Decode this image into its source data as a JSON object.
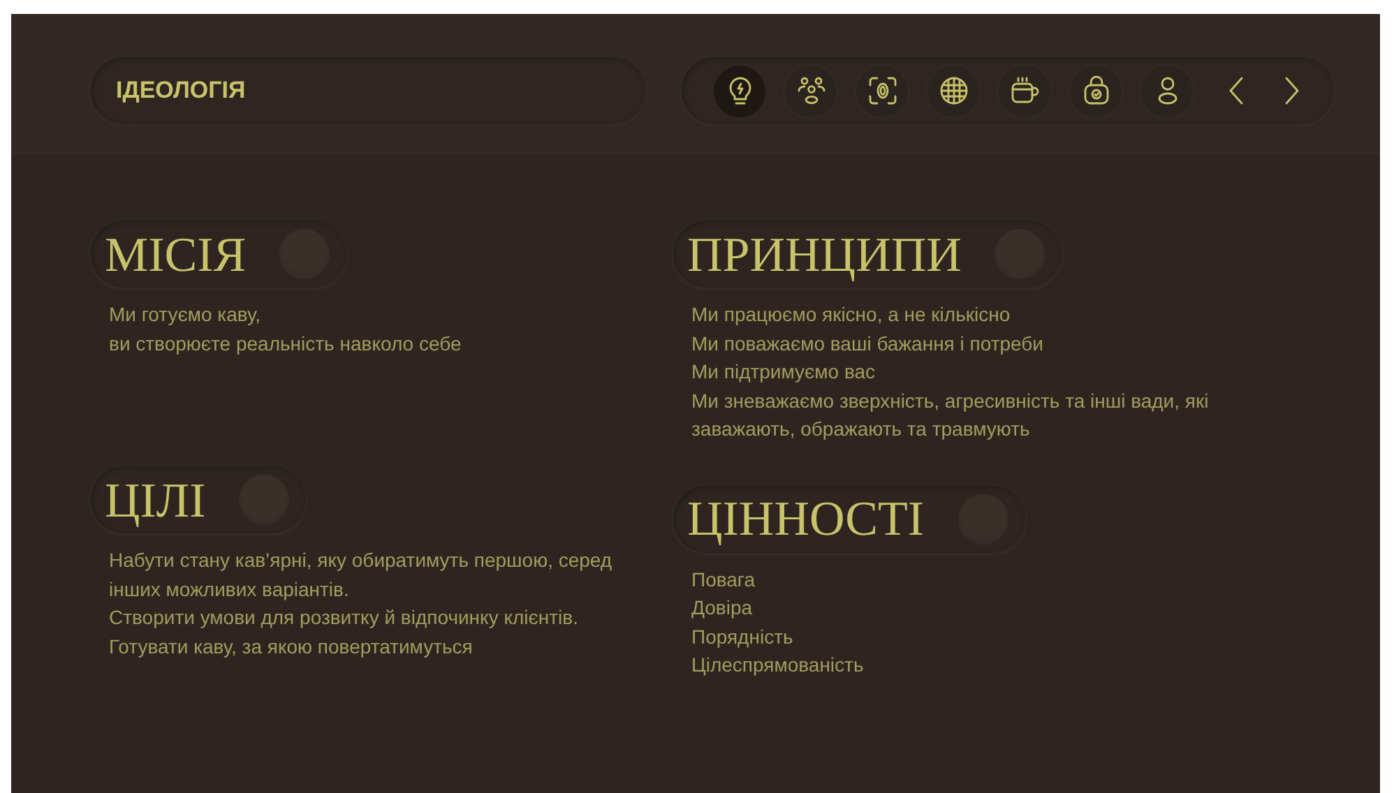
{
  "header": {
    "title": "ІДЕОЛОГІЯ"
  },
  "nav": {
    "icons": [
      {
        "kind": "bulb",
        "selected": true
      },
      {
        "kind": "people",
        "selected": false
      },
      {
        "kind": "scan",
        "selected": false
      },
      {
        "kind": "globe",
        "selected": false
      },
      {
        "kind": "mug",
        "selected": false
      },
      {
        "kind": "lock",
        "selected": false
      },
      {
        "kind": "user",
        "selected": false
      }
    ],
    "arrows": [
      {
        "kind": "prev"
      },
      {
        "kind": "next"
      }
    ]
  },
  "columns": [
    [
      {
        "title": "МІСІЯ",
        "lines": [
          "Ми готуємо каву,",
          "ви створюєте реальність навколо себе"
        ]
      },
      {
        "title": "ЦІЛІ",
        "lines": [
          "Набути стану кав’ярні, яку обиратимуть першою, серед інших можливих варіантів.",
          "Створити умови для розвитку й відпочинку клієнтів.",
          "Готувати каву, за якою повертатимуться"
        ]
      }
    ],
    [
      {
        "title": "ПРИНЦИПИ",
        "lines": [
          "Ми працюємо якісно, а не кількісно",
          "Ми поважаємо ваші бажання і потреби",
          "Ми підтримуємо вас",
          "Ми зневажаємо зверхність, агресивність та інші вади, які заважають, ображають та травмують"
        ]
      },
      {
        "title": "ЦІННОСТІ",
        "lines": [
          "Повага",
          "Довіра",
          "Порядність",
          "Цілеспрямованість"
        ]
      }
    ]
  ]
}
